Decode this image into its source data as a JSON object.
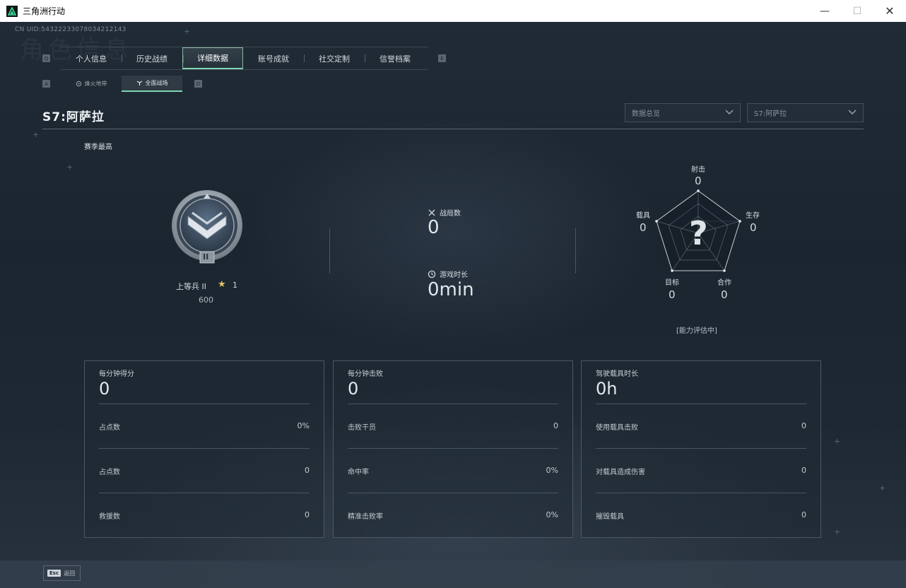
{
  "window": {
    "title": "三角洲行动"
  },
  "header": {
    "uid": "CN UID:543222330780342121​43",
    "ghost_text": "角色信息"
  },
  "tabs": {
    "items": [
      {
        "label": "个人信息"
      },
      {
        "label": "历史战绩"
      },
      {
        "label": "详细数据",
        "active": true
      },
      {
        "label": "账号成就"
      },
      {
        "label": "社交定制"
      },
      {
        "label": "信誉档案"
      }
    ],
    "key_left": "Q",
    "key_right": "E"
  },
  "subtabs": {
    "items": [
      {
        "label": "烽火地带"
      },
      {
        "label": "全面战场",
        "active": true
      }
    ],
    "key_left": "A",
    "key_right": "D"
  },
  "season": {
    "title": "S7:阿萨拉",
    "best_label": "赛季最高"
  },
  "filters": {
    "data_scope": "数据总览",
    "season": "S7:阿萨拉"
  },
  "rank": {
    "name": "上等兵 II",
    "stars": "1",
    "score": "600",
    "badge_numeral": "II"
  },
  "overview": {
    "battles_label": "战局数",
    "battles_value": "0",
    "playtime_label": "游戏时长",
    "playtime_value": "0min"
  },
  "radar": {
    "shooting_label": "射击",
    "shooting_value": "0",
    "survival_label": "生存",
    "survival_value": "0",
    "teamwork_label": "合作",
    "teamwork_value": "0",
    "objective_label": "目标",
    "objective_value": "0",
    "vehicle_label": "载具",
    "vehicle_value": "0",
    "center_mark": "?",
    "status": "[能力评估中]"
  },
  "cards": [
    {
      "title": "每分钟得分",
      "value": "0",
      "rows": [
        {
          "label": "占点数",
          "value": "0%"
        },
        {
          "label": "占点数",
          "value": "0"
        },
        {
          "label": "救援数",
          "value": "0"
        }
      ]
    },
    {
      "title": "每分钟击败",
      "value": "0",
      "rows": [
        {
          "label": "击败干员",
          "value": "0"
        },
        {
          "label": "命中率",
          "value": "0%"
        },
        {
          "label": "精准击败率",
          "value": "0%"
        }
      ]
    },
    {
      "title": "驾驶载具时长",
      "value": "0h",
      "rows": [
        {
          "label": "使用载具击败",
          "value": "0"
        },
        {
          "label": "对载具造成伤害",
          "value": "0"
        },
        {
          "label": "摧毁载具",
          "value": "0"
        }
      ]
    }
  ],
  "footer": {
    "esc_key": "Esc",
    "back_label": "返回"
  }
}
